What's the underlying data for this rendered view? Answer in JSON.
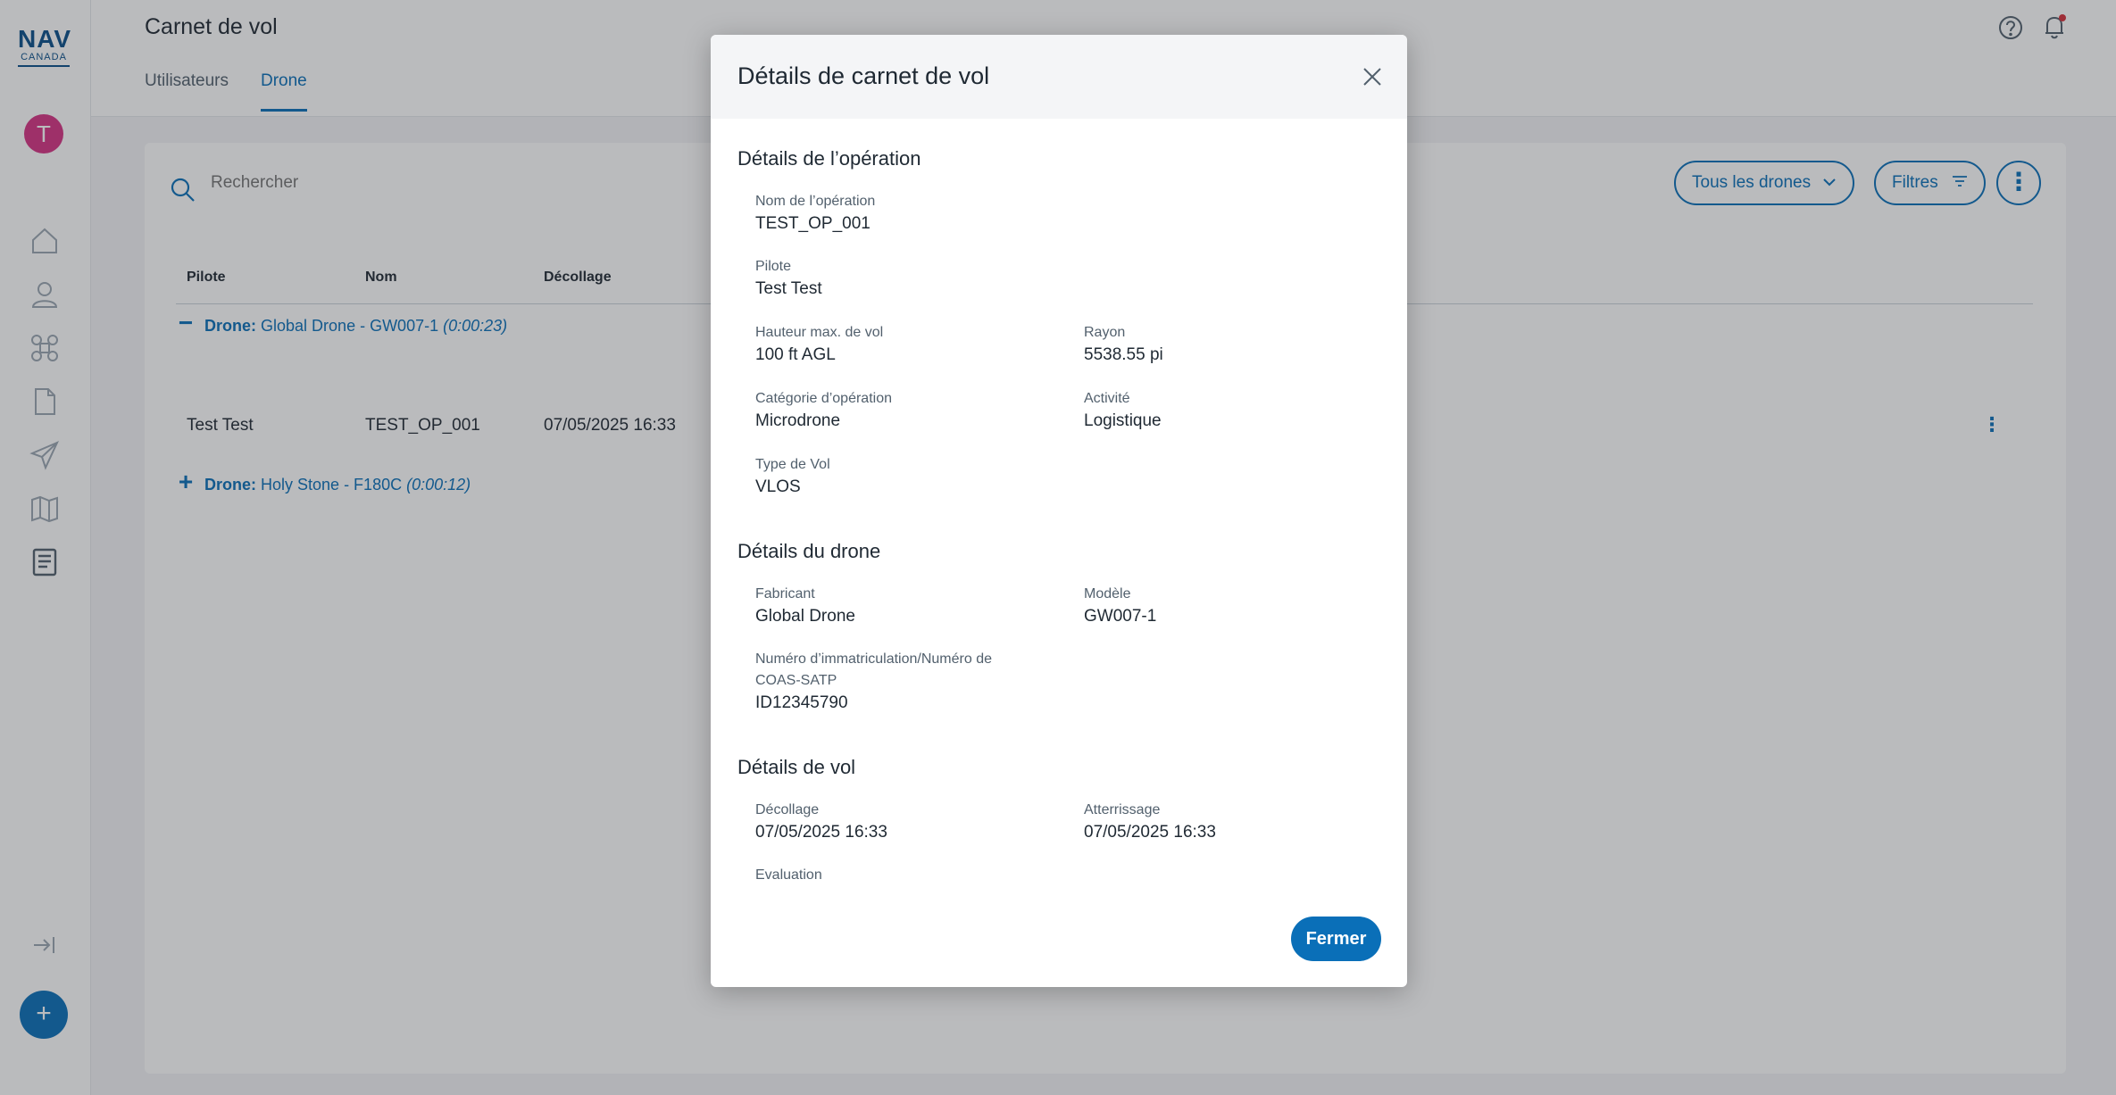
{
  "brand": {
    "nav": "NAV",
    "canada": "CANADA"
  },
  "user": {
    "initial": "T"
  },
  "header": {
    "title": "Carnet de vol",
    "tabs": [
      {
        "label": "Utilisateurs",
        "active": false
      },
      {
        "label": "Drone",
        "active": true
      }
    ]
  },
  "toolbar": {
    "search_placeholder": "Rechercher",
    "drones_filter_label": "Tous les drones",
    "filters_label": "Filtres"
  },
  "table": {
    "columns": [
      "Pilote",
      "Nom",
      "Décollage"
    ],
    "groups": [
      {
        "expanded": true,
        "sign": "−",
        "prefix": "Drone:",
        "name": "Global Drone - GW007-1",
        "duration": "(0:00:23)",
        "rows": [
          {
            "pilote": "Test Test",
            "nom": "TEST_OP_001",
            "decollage": "07/05/2025 16:33"
          }
        ]
      },
      {
        "expanded": false,
        "sign": "+",
        "prefix": "Drone:",
        "name": "Holy Stone - F180C",
        "duration": "(0:00:12)",
        "rows": []
      }
    ]
  },
  "modal": {
    "title": "Détails de carnet de vol",
    "operation": {
      "title": "Détails de l’opération",
      "fields": {
        "nom_label": "Nom de l’opération",
        "nom": "TEST_OP_001",
        "pilote_label": "Pilote",
        "pilote": "Test Test",
        "hauteur_label": "Hauteur max. de vol",
        "hauteur": "100 ft AGL",
        "rayon_label": "Rayon",
        "rayon": "5538.55 pi",
        "categorie_label": "Catégorie d’opération",
        "categorie": "Microdrone",
        "activite_label": "Activité",
        "activite": "Logistique",
        "type_label": "Type de Vol",
        "type": "VLOS"
      }
    },
    "drone": {
      "title": "Détails du drone",
      "fields": {
        "fabricant_label": "Fabricant",
        "fabricant": "Global Drone",
        "modele_label": "Modèle",
        "modele": "GW007-1",
        "immat_label": "Numéro d’immatriculation/Numéro de COAS-SATP",
        "immat": "ID12345790"
      }
    },
    "vol": {
      "title": "Détails de vol",
      "fields": {
        "decollage_label": "Décollage",
        "decollage": "07/05/2025 16:33",
        "atterrissage_label": "Atterrissage",
        "atterrissage": "07/05/2025 16:33",
        "evaluation_label": "Evaluation"
      }
    },
    "close_button": "Fermer"
  },
  "colors": {
    "primary": "#0a6fb8",
    "avatar": "#d63384",
    "notification_dot": "#d6303a"
  }
}
